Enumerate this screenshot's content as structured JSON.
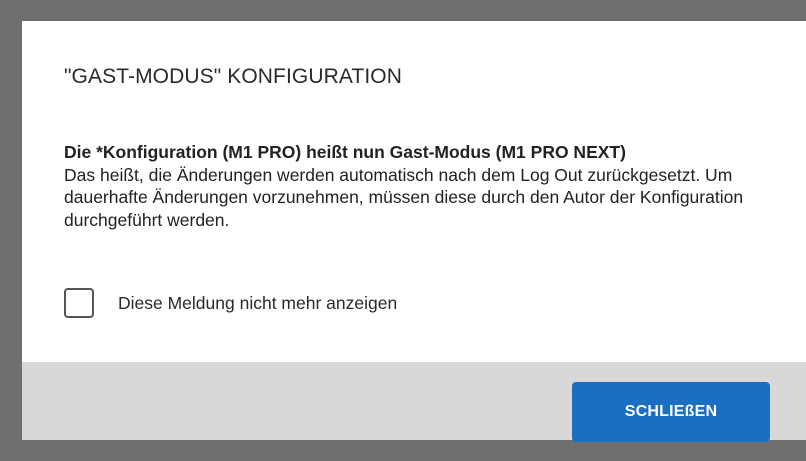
{
  "dialog": {
    "title": "\"GAST-MODUS\" KONFIGURATION",
    "message_bold": "Die *Konfiguration (M1 PRO) heißt nun Gast-Modus (M1 PRO NEXT)",
    "message_body": "Das heißt, die Änderungen werden automatisch nach dem Log Out zurückgesetzt. Um dauerhafte Änderungen vorzunehmen, müssen diese durch den Autor der Konfiguration durchgeführt werden.",
    "checkbox": {
      "label": "Diese Meldung nicht mehr anzeigen",
      "checked": false
    },
    "close_label": "SCHLIEßEN"
  },
  "colors": {
    "backdrop": "#6f6f6f",
    "footer": "#d8d8d8",
    "primary_button": "#1a6fc2"
  }
}
